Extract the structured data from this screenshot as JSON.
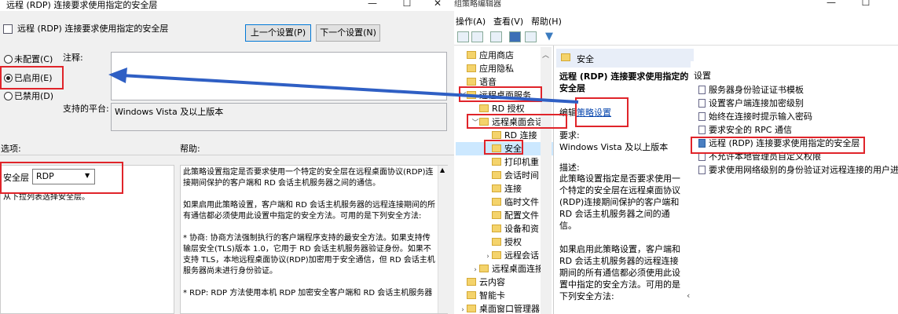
{
  "dialog": {
    "window_title": "远程 (RDP) 连接要求使用指定的安全层",
    "window_controls": {
      "minimize": "—",
      "maximize": "☐",
      "close": "✕"
    },
    "header_title": "远程 (RDP) 连接要求使用指定的安全层",
    "prev_button": "上一个设置(P)",
    "next_button": "下一个设置(N)",
    "radio_not_configured": "未配置(C)",
    "radio_enabled": "已启用(E)",
    "radio_disabled": "已禁用(D)",
    "selected_radio": "enabled",
    "comment_label": "注释:",
    "comment_value": "",
    "platform_label": "支持的平台:",
    "platform_value": "Windows Vista 及以上版本",
    "options_label": "选项:",
    "help_label": "帮助:",
    "security_layer_label": "安全层",
    "security_layer_value": "RDP",
    "options_hint": "从下拉列表选择安全层。",
    "help_text": "此策略设置指定是否要求使用一个特定的安全层在远程桌面协议(RDP)连接期间保护的客户端和 RD 会话主机服务器之间的通信。\n\n如果启用此策略设置，客户端和 RD 会话主机服务器的远程连接期间的所有通信都必须使用此设置中指定的安全方法。可用的是下列安全方法:\n\n* 协商: 协商方法强制执行的客户端程序支持的最安全方法。如果支持传输层安全(TLS)版本 1.0，它用于 RD 会话主机服务器验证身份。如果不支持 TLS，本地远程桌面协议(RDP)加密用于安全通信，但 RD 会话主机服务器尚未进行身份验证。\n\n* RDP: RDP 方法使用本机 RDP 加密安全客户端和 RD 会话主机服务器"
  },
  "console": {
    "window_title": "组策略编辑器",
    "window_controls": {
      "minimize": "—",
      "maximize": "☐"
    },
    "menus": [
      "操作(A)",
      "查看(V)",
      "帮助(H)"
    ],
    "tree": [
      {
        "label": "应用商店",
        "indent": 0,
        "chevron": ""
      },
      {
        "label": "应用隐私",
        "indent": 0,
        "chevron": ""
      },
      {
        "label": "语音",
        "indent": 0,
        "chevron": ""
      },
      {
        "label": "远程桌面服务",
        "indent": 0,
        "chevron": "﹀"
      },
      {
        "label": "RD 授权",
        "indent": 1,
        "chevron": ""
      },
      {
        "label": "远程桌面会话",
        "indent": 1,
        "chevron": "﹀"
      },
      {
        "label": "RD 连接",
        "indent": 2,
        "chevron": ""
      },
      {
        "label": "安全",
        "indent": 2,
        "chevron": ""
      },
      {
        "label": "打印机重",
        "indent": 2,
        "chevron": ""
      },
      {
        "label": "会话时间",
        "indent": 2,
        "chevron": ""
      },
      {
        "label": "连接",
        "indent": 2,
        "chevron": ""
      },
      {
        "label": "临时文件",
        "indent": 2,
        "chevron": ""
      },
      {
        "label": "配置文件",
        "indent": 2,
        "chevron": ""
      },
      {
        "label": "设备和资",
        "indent": 2,
        "chevron": ""
      },
      {
        "label": "授权",
        "indent": 2,
        "chevron": ""
      },
      {
        "label": "远程会话",
        "indent": 2,
        "chevron": "›"
      },
      {
        "label": "远程桌面连接",
        "indent": 1,
        "chevron": "›"
      },
      {
        "label": "云内容",
        "indent": 0,
        "chevron": ""
      },
      {
        "label": "智能卡",
        "indent": 0,
        "chevron": ""
      },
      {
        "label": "桌面窗口管理器",
        "indent": 0,
        "chevron": "›"
      }
    ],
    "selected_folder": "安全",
    "desc_header": "安全",
    "desc_title": "远程 (RDP) 连接要求使用指定的安全层",
    "edit_prefix": "编辑",
    "edit_link": "策略设置",
    "requirements_label": "要求:",
    "requirements_value": "Windows Vista 及以上版本",
    "description_label": "描述:",
    "description_text": "此策略设置指定是否要求使用一个特定的安全层在远程桌面协议(RDP)连接期间保护的客户端和 RD 会话主机服务器之间的通信。\n\n如果启用此策略设置，客户端和 RD 会话主机服务器的远程连接期间的所有通信都必须使用此设置中指定的安全方法。可用的是下列安全方法:\n\n* 协商: 协商方法强制执行的客户端程序支持的最安全方法。如果",
    "settings_header": "设置",
    "settings": [
      "服务器身份验证证书模板",
      "设置客户端连接加密级别",
      "始终在连接时提示输入密码",
      "要求安全的 RPC 通信",
      "远程 (RDP) 连接要求使用指定的安全层",
      "不允许本地管理员自定义权限",
      "要求使用网络级别的身份验证对远程连接的用户进行身"
    ],
    "selected_setting_index": 4
  },
  "colors": {
    "highlight_border": "#e0242a",
    "arrow": "#2f5fc4",
    "link": "#0645ad",
    "selection": "#cce8ff"
  }
}
